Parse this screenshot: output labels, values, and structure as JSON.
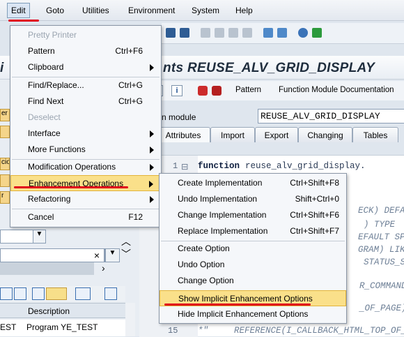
{
  "menubar": {
    "items": [
      "Edit",
      "Goto",
      "Utilities",
      "Environment",
      "System",
      "Help"
    ]
  },
  "title": {
    "left_fragment": "i",
    "main": "nts REUSE_ALV_GRID_DISPLAY"
  },
  "app_toolbar": {
    "pattern": "Pattern",
    "function_module_doc": "Function Module Documentation"
  },
  "function_module": {
    "label": "n module",
    "value": "REUSE_ALV_GRID_DISPLAY"
  },
  "tabs": [
    "Attributes",
    "Import",
    "Export",
    "Changing",
    "Tables"
  ],
  "editor": {
    "line1_number": "1",
    "line1_keyword": "function",
    "line1_rest": "reuse_alv_grid_display.",
    "line15_number": "15",
    "line15_prefix": "*\"",
    "line15_text": "REFERENCE(I_CALLBACK_HTML_TOP_OF_P",
    "frag_1": "ECK) DEFAU",
    "frag_2": ") TYPE  CH",
    "frag_3": "EFAULT SPA",
    "frag_4": "GRAM) LIKE",
    "frag_5": "STATUS_SET",
    "frag_6": "R_COMMAND)",
    "frag_7": "_OF_PAGE)"
  },
  "left_pane": {
    "btn_labels": [
      "er",
      "",
      "cio",
      "",
      "r"
    ],
    "col_header": "Description",
    "row_text": "Program YE_TEST",
    "row_prefix": "EST"
  },
  "edit_menu": {
    "items": [
      {
        "label": "Pretty Printer",
        "shortcut": "",
        "disabled": true
      },
      {
        "label": "Pattern",
        "shortcut": "Ctrl+F6"
      },
      {
        "label": "Clipboard",
        "shortcut": ""
      },
      {
        "label": "Find/Replace...",
        "shortcut": "Ctrl+G"
      },
      {
        "label": "Find Next",
        "shortcut": "Ctrl+G"
      },
      {
        "label": "Deselect",
        "shortcut": "",
        "disabled": true
      },
      {
        "label": "Interface",
        "shortcut": ""
      },
      {
        "label": "More Functions",
        "shortcut": ""
      },
      {
        "label": "Modification Operations",
        "shortcut": ""
      },
      {
        "label": "Enhancement Operations",
        "shortcut": ""
      },
      {
        "label": "Refactoring",
        "shortcut": ""
      },
      {
        "label": "Cancel",
        "shortcut": "F12"
      }
    ]
  },
  "enhancement_submenu": {
    "items": [
      {
        "label": "Create Implementation",
        "shortcut": "Ctrl+Shift+F8"
      },
      {
        "label": "Undo Implementation",
        "shortcut": "Shift+Ctrl+0"
      },
      {
        "label": "Change Implementation",
        "shortcut": "Ctrl+Shift+F6"
      },
      {
        "label": "Replace Implementation",
        "shortcut": "Ctrl+Shift+F7"
      },
      {
        "label": "Create Option",
        "shortcut": ""
      },
      {
        "label": "Undo Option",
        "shortcut": ""
      },
      {
        "label": "Change Option",
        "shortcut": ""
      },
      {
        "label": "Show Implicit Enhancement Options",
        "shortcut": ""
      },
      {
        "label": "Hide Implicit Enhancement Options",
        "shortcut": ""
      }
    ]
  },
  "colors": {
    "highlight": "#fae08a",
    "annotation_red": "#e0001a"
  }
}
